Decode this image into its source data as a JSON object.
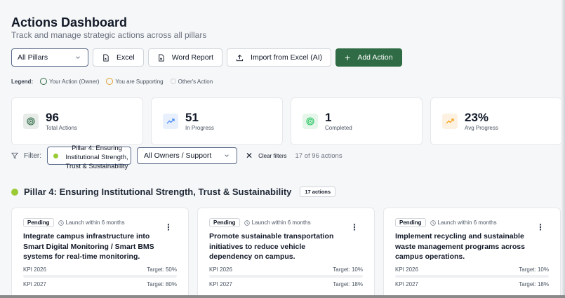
{
  "header": {
    "title": "Actions Dashboard",
    "subtitle": "Track and manage strategic actions across all pillars"
  },
  "toolbar": {
    "pillar_select": "All Pillars",
    "excel_label": "Excel",
    "word_label": "Word Report",
    "import_label": "Import from Excel (AI)",
    "add_label": "Add Action"
  },
  "legend": {
    "label": "Legend:",
    "owner": "Your Action (Owner)",
    "supporting": "You are Supporting",
    "other": "Other's Action"
  },
  "stats": [
    {
      "value": "96",
      "label": "Total Actions",
      "icon": "target-icon",
      "color": "#2f6b45"
    },
    {
      "value": "51",
      "label": "In Progress",
      "icon": "trending-up-icon",
      "color": "#3b82f6"
    },
    {
      "value": "1",
      "label": "Completed",
      "icon": "target-icon",
      "color": "#22c55e"
    },
    {
      "value": "23%",
      "label": "Avg Progress",
      "icon": "trending-up-icon",
      "color": "#f59e0b"
    }
  ],
  "filter": {
    "label": "Filter:",
    "pillar_value": "Pillar 4: Ensuring Institutional Strength, Trust & Sustainability",
    "owner_value": "All Owners / Support",
    "clear_label": "Clear filters",
    "count_text": "17 of 96 actions"
  },
  "pillar": {
    "title": "Pillar 4: Ensuring Institutional Strength, Trust & Sustainability",
    "badge": "17 actions"
  },
  "cards": [
    {
      "status": "Pending",
      "timeline": "Launch within 6 months",
      "title": "Integrate campus infrastructure into Smart Digital Monitoring / Smart BMS systems for real-time monitoring.",
      "kpi1_label": "KPI 2026",
      "kpi1_target": "Target: 50%",
      "kpi2_label": "KPI 2027",
      "kpi2_target": "Target: 80%"
    },
    {
      "status": "Pending",
      "timeline": "Launch within 6 months",
      "title": "Promote sustainable transportation initiatives to reduce vehicle dependency on campus.",
      "kpi1_label": "KPI 2026",
      "kpi1_target": "Target: 10%",
      "kpi2_label": "KPI 2027",
      "kpi2_target": "Target: 18%"
    },
    {
      "status": "Pending",
      "timeline": "Launch within 6 months",
      "title": "Implement recycling and sustainable waste management programs across campus operations.",
      "kpi1_label": "KPI 2026",
      "kpi1_target": "Target: 10%",
      "kpi2_label": "KPI 2027",
      "kpi2_target": "Target: 18%"
    }
  ]
}
